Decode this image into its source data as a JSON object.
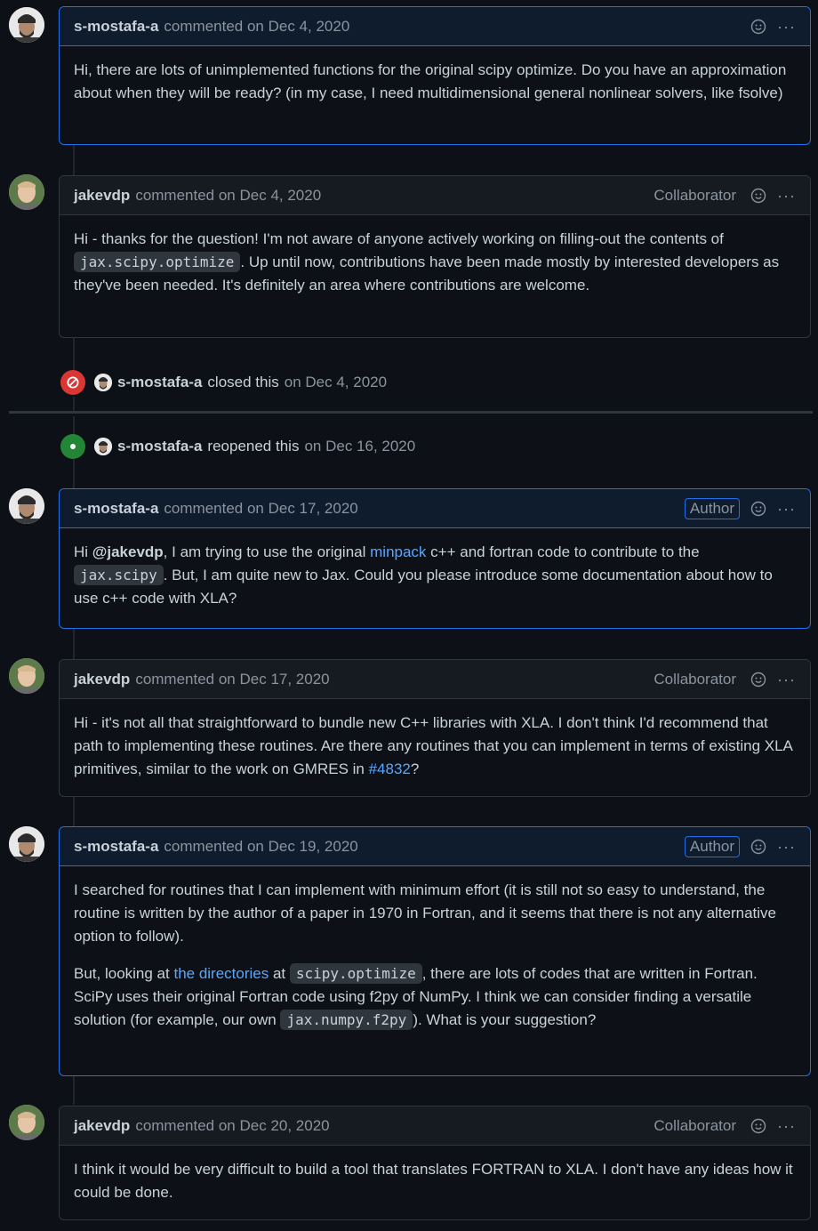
{
  "colors": {
    "bg": "#0d1117",
    "link": "#58a6ff",
    "closed": "#da3633",
    "reopened": "#238636",
    "author_border": "#1f6feb"
  },
  "icons": {
    "emoji": "smiley-icon",
    "more": "kebab-horizontal-icon",
    "closed": "circle-slash-icon",
    "reopened": "dot-fill-icon"
  },
  "comments": [
    {
      "user": "s-mostafa-a",
      "meta": "commented on Dec 4, 2020",
      "badge": "",
      "body": {
        "text": "Hi, there are lots of unimplemented functions for the original scipy optimize. Do you have an approximation about when they will be ready? (in my case, I need multidimensional general nonlinear solvers, like fsolve)"
      }
    },
    {
      "user": "jakevdp",
      "meta": "commented on Dec 4, 2020",
      "badge": "Collaborator",
      "body": {
        "t1": "Hi - thanks for the question! I'm not aware of anyone actively working on filling-out the contents of ",
        "code1": "jax.scipy.optimize",
        "t2": ". Up until now, contributions have been made mostly by interested developers as they've been needed. It's definitely an area where contributions are welcome."
      }
    },
    {
      "user": "s-mostafa-a",
      "meta": "commented on Dec 17, 2020",
      "badge": "Author",
      "body": {
        "t1": "Hi ",
        "mention": "@jakevdp",
        "t2": ", I am trying to use the original ",
        "link": "minpack",
        "t3": " c++ and fortran code to contribute to the ",
        "code1": "jax.scipy",
        "t4": ". But, I am quite new to Jax. Could you please introduce some documentation about how to use c++ code with XLA?"
      }
    },
    {
      "user": "jakevdp",
      "meta": "commented on Dec 17, 2020",
      "badge": "Collaborator",
      "body": {
        "t1": "Hi - it's not all that straightforward to bundle new C++ libraries with XLA. I don't think I'd recommend that path to implementing these routines. Are there any routines that you can implement in terms of existing XLA primitives, similar to the work on GMRES in ",
        "link": "#4832",
        "t2": "?"
      }
    },
    {
      "user": "s-mostafa-a",
      "meta": "commented on Dec 19, 2020",
      "badge": "Author",
      "body": {
        "p1": "I searched for routines that I can implement with minimum effort (it is still not so easy to understand, the routine is written by the author of a paper in 1970 in Fortran, and it seems that there is not any alternative option to follow).",
        "t1": "But, looking at ",
        "link": "the directories",
        "t2": " at ",
        "code1": "scipy.optimize",
        "t3": ", there are lots of codes that are written in Fortran. SciPy uses their original Fortran code using f2py of NumPy. I think we can consider finding a versatile solution (for example, our own ",
        "code2": "jax.numpy.f2py",
        "t4": "). What is your suggestion?"
      }
    },
    {
      "user": "jakevdp",
      "meta": "commented on Dec 20, 2020",
      "badge": "Collaborator",
      "body": {
        "text": "I think it would be very difficult to build a tool that translates FORTRAN to XLA. I don't have any ideas how it could be done."
      }
    }
  ],
  "events": [
    {
      "user": "s-mostafa-a",
      "action": "closed this",
      "date": "on Dec 4, 2020"
    },
    {
      "user": "s-mostafa-a",
      "action": "reopened this",
      "date": "on Dec 16, 2020"
    }
  ]
}
